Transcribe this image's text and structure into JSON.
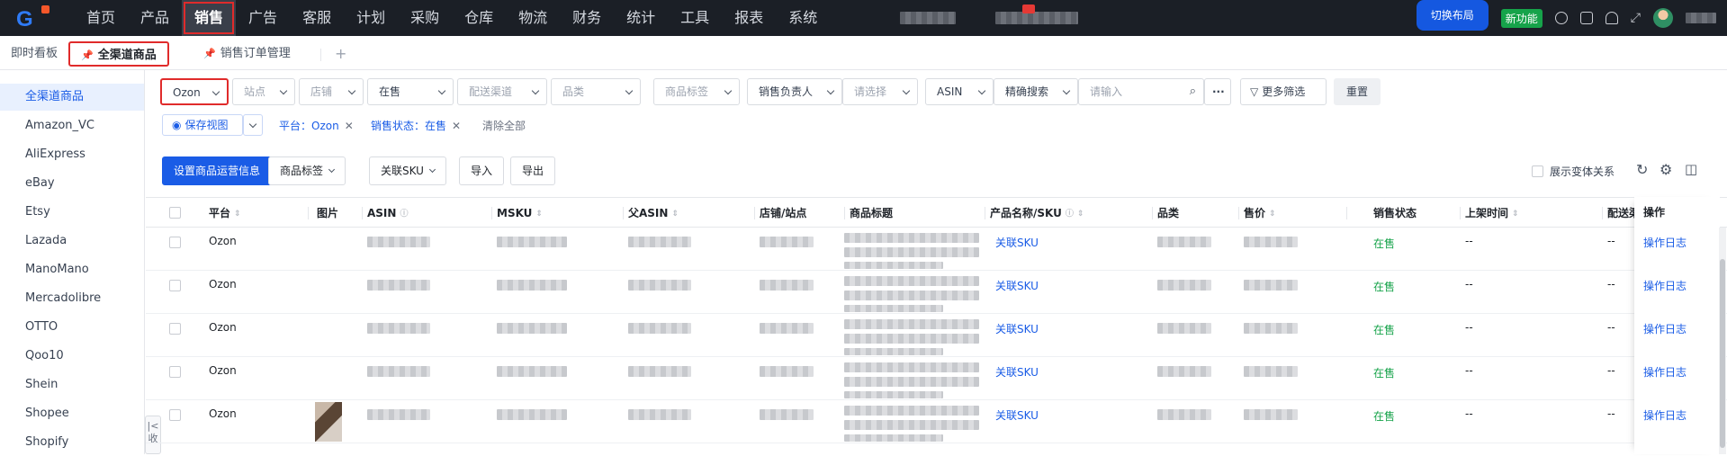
{
  "topbar": {
    "logo_text": "G",
    "nav": [
      "首页",
      "产品",
      "销售",
      "广告",
      "客服",
      "计划",
      "采购",
      "仓库",
      "物流",
      "财务",
      "统计",
      "工具",
      "报表",
      "系统"
    ],
    "active_nav": "销售",
    "switch_layout": "切换布局",
    "new_feature": "新功能"
  },
  "tabs": {
    "dashboard": "即时看板",
    "all_channel": "全渠道商品",
    "sales_order": "销售订单管理",
    "add": "+"
  },
  "sidebar": {
    "items": [
      "全渠道商品",
      "Amazon_VC",
      "AliExpress",
      "eBay",
      "Etsy",
      "Lazada",
      "ManoMano",
      "Mercadolibre",
      "OTTO",
      "Qoo10",
      "Shein",
      "Shopee",
      "Shopify"
    ],
    "collapse": "|<",
    "collapse_label": "收"
  },
  "filters": {
    "platform": "Ozon",
    "site_ph": "站点",
    "store_ph": "店铺",
    "sale_status": "在售",
    "channel_ph": "配送渠道",
    "category_ph": "品类",
    "product_tag_ph": "商品标签",
    "sales_owner": "销售负责人",
    "select_ph": "请选择",
    "asin": "ASIN",
    "exact_search": "精确搜索",
    "input_ph": "请输入",
    "more": "···",
    "more_filter": "更多筛选",
    "reset": "重置",
    "save_view": "保存视图",
    "chip_platform": "平台：Ozon",
    "chip_status": "销售状态：在售",
    "clear_all": "清除全部"
  },
  "actions": {
    "set_info": "设置商品运营信息",
    "product_tag": "商品标签",
    "link_sku": "关联SKU",
    "import": "导入",
    "export": "导出",
    "show_variant": "展示变体关系"
  },
  "table": {
    "headers": [
      "平台",
      "图片",
      "ASIN",
      "MSKU",
      "父ASIN",
      "店铺/站点",
      "商品标题",
      "产品名称/SKU",
      "品类",
      "售价",
      "销售状态",
      "上架时间",
      "配送渠",
      "操作"
    ],
    "rows": [
      {
        "platform": "Ozon",
        "sku": "关联SKU",
        "status": "在售",
        "listed": "--",
        "ship": "--",
        "op": "操作日志"
      },
      {
        "platform": "Ozon",
        "sku": "关联SKU",
        "status": "在售",
        "listed": "--",
        "ship": "--",
        "op": "操作日志"
      },
      {
        "platform": "Ozon",
        "sku": "关联SKU",
        "status": "在售",
        "listed": "--",
        "ship": "--",
        "op": "操作日志"
      },
      {
        "platform": "Ozon",
        "sku": "关联SKU",
        "status": "在售",
        "listed": "--",
        "ship": "--",
        "op": "操作日志"
      },
      {
        "platform": "Ozon",
        "sku": "关联SKU",
        "status": "在售",
        "listed": "--",
        "ship": "--",
        "op": "操作日志"
      }
    ]
  },
  "colors": {
    "accent": "#1a5ce6",
    "highlight": "#e02b2b",
    "success": "#16a34a",
    "topbar": "#1b1f26"
  }
}
